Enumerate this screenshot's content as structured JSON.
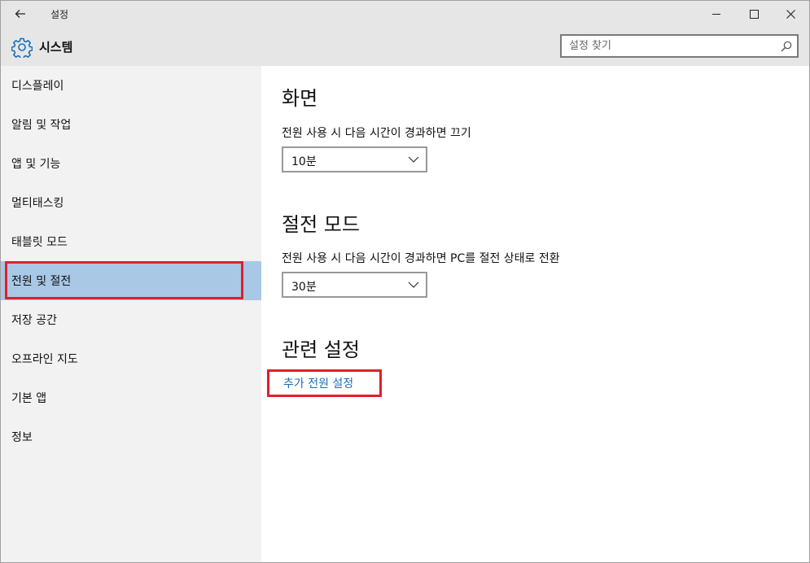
{
  "window": {
    "title": "설정"
  },
  "header": {
    "title": "시스템"
  },
  "search": {
    "placeholder": "설정 찾기"
  },
  "sidebar": {
    "items": [
      {
        "label": "디스플레이",
        "selected": false
      },
      {
        "label": "알림 및 작업",
        "selected": false
      },
      {
        "label": "앱 및 기능",
        "selected": false
      },
      {
        "label": "멀티태스킹",
        "selected": false
      },
      {
        "label": "태블릿 모드",
        "selected": false
      },
      {
        "label": "전원 및 절전",
        "selected": true
      },
      {
        "label": "저장 공간",
        "selected": false
      },
      {
        "label": "오프라인 지도",
        "selected": false
      },
      {
        "label": "기본 앱",
        "selected": false
      },
      {
        "label": "정보",
        "selected": false
      }
    ]
  },
  "main": {
    "screen": {
      "title": "화면",
      "desc": "전원 사용 시 다음 시간이 경과하면 끄기",
      "value": "10분"
    },
    "sleep": {
      "title": "절전 모드",
      "desc": "전원 사용 시 다음 시간이 경과하면 PC를 절전 상태로 전환",
      "value": "30분"
    },
    "related": {
      "title": "관련 설정",
      "link": "추가 전원 설정"
    }
  },
  "colors": {
    "selected_bg": "#a8c8e6",
    "highlight": "#e0202a",
    "link": "#1a6fb8",
    "chrome": "#e6e6e6",
    "sidebar_bg": "#f2f2f2"
  }
}
